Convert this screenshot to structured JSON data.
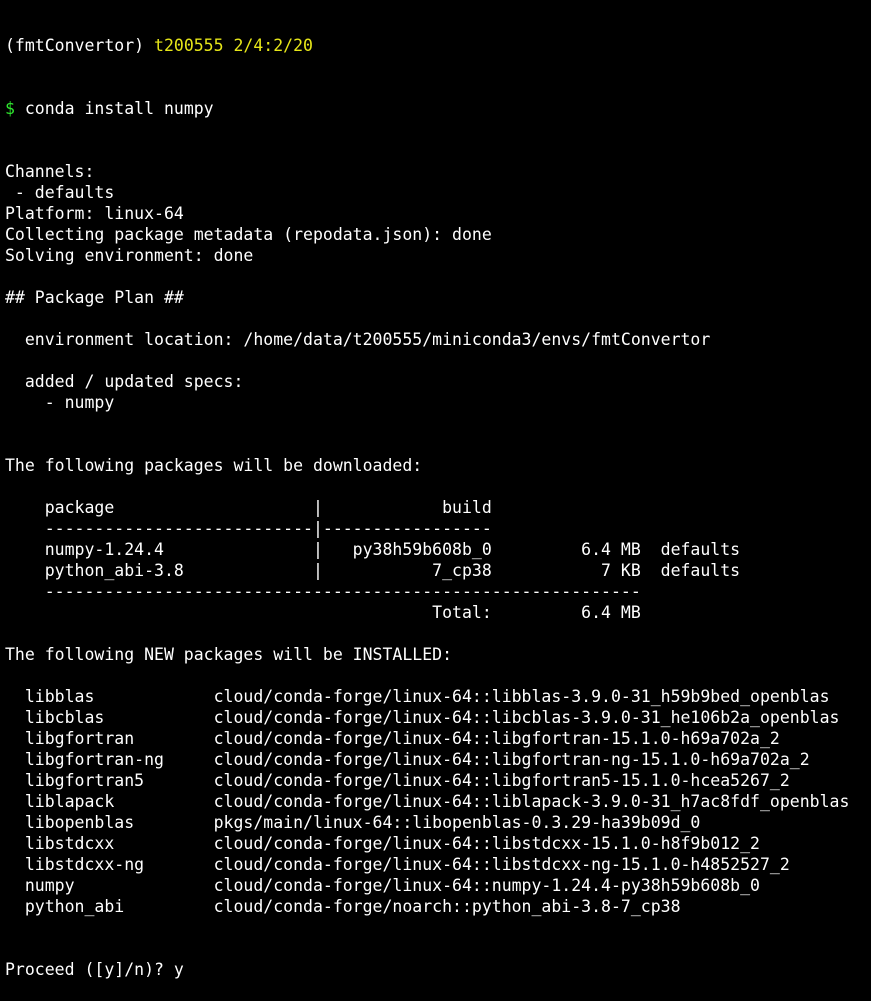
{
  "prompt": {
    "env": "(fmtConvertor)",
    "user_host": "t200555",
    "cwd": "2/4:2/20",
    "symbol": "$",
    "command": "conda install numpy"
  },
  "lines": [
    "Channels:",
    " - defaults",
    "Platform: linux-64",
    "Collecting package metadata (repodata.json): done",
    "Solving environment: done",
    "",
    "## Package Plan ##",
    "",
    "  environment location: /home/data/t200555/miniconda3/envs/fmtConvertor",
    "",
    "  added / updated specs:",
    "    - numpy",
    "",
    "",
    "The following packages will be downloaded:",
    "",
    "    package                    |            build",
    "    ---------------------------|-----------------",
    "    numpy-1.24.4               |   py38h59b608b_0         6.4 MB  defaults",
    "    python_abi-3.8             |           7_cp38           7 KB  defaults",
    "    ------------------------------------------------------------",
    "                                           Total:         6.4 MB",
    "",
    "The following NEW packages will be INSTALLED:",
    "",
    "  libblas            cloud/conda-forge/linux-64::libblas-3.9.0-31_h59b9bed_openblas",
    "  libcblas           cloud/conda-forge/linux-64::libcblas-3.9.0-31_he106b2a_openblas",
    "  libgfortran        cloud/conda-forge/linux-64::libgfortran-15.1.0-h69a702a_2",
    "  libgfortran-ng     cloud/conda-forge/linux-64::libgfortran-ng-15.1.0-h69a702a_2",
    "  libgfortran5       cloud/conda-forge/linux-64::libgfortran5-15.1.0-hcea5267_2",
    "  liblapack          cloud/conda-forge/linux-64::liblapack-3.9.0-31_h7ac8fdf_openblas",
    "  libopenblas        pkgs/main/linux-64::libopenblas-0.3.29-ha39b09d_0",
    "  libstdcxx          cloud/conda-forge/linux-64::libstdcxx-15.1.0-h8f9b012_2",
    "  libstdcxx-ng       cloud/conda-forge/linux-64::libstdcxx-ng-15.1.0-h4852527_2",
    "  numpy              cloud/conda-forge/linux-64::numpy-1.24.4-py38h59b608b_0",
    "  python_abi         cloud/conda-forge/noarch::python_abi-3.8-7_cp38",
    "",
    "",
    "Proceed ([y]/n)? y"
  ],
  "colors": {
    "background": "#000000",
    "foreground": "#ffffff",
    "prompt_green": "#2ee62e",
    "prompt_yellow": "#e6e619"
  }
}
